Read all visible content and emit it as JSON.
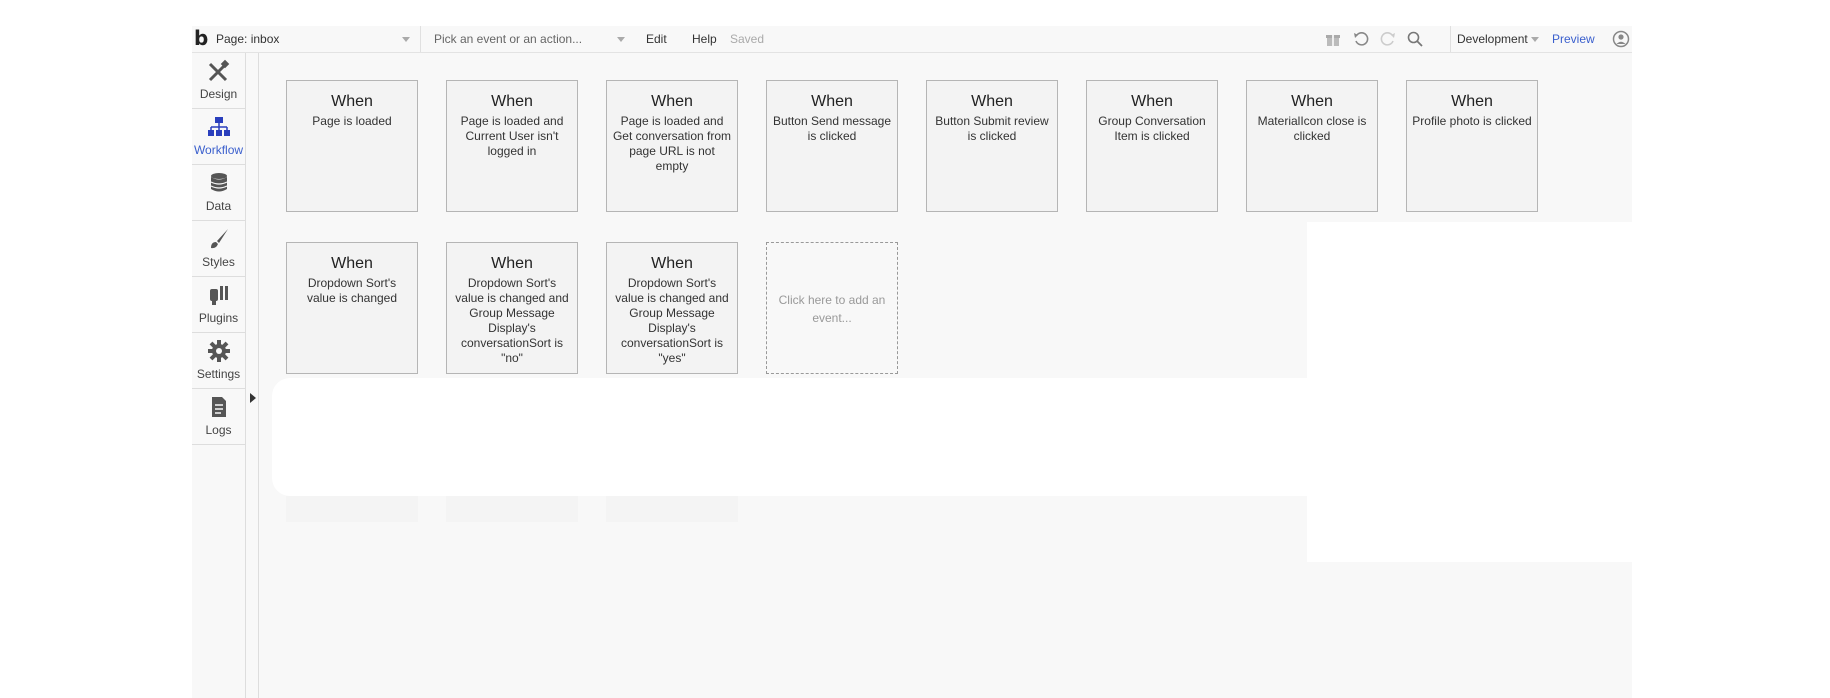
{
  "topbar": {
    "logo": "b",
    "page_label": "Page: inbox",
    "event_placeholder": "Pick an event or an action...",
    "menu": [
      "Edit",
      "Help"
    ],
    "status": "Saved",
    "environment": "Development",
    "preview": "Preview"
  },
  "sidebar": {
    "items": [
      {
        "label": "Design",
        "icon": "design-icon"
      },
      {
        "label": "Workflow",
        "icon": "workflow-icon",
        "active": true
      },
      {
        "label": "Data",
        "icon": "database-icon"
      },
      {
        "label": "Styles",
        "icon": "brush-icon"
      },
      {
        "label": "Plugins",
        "icon": "plug-icon"
      },
      {
        "label": "Settings",
        "icon": "gear-icon"
      },
      {
        "label": "Logs",
        "icon": "document-icon"
      }
    ]
  },
  "workflows": {
    "row1": [
      {
        "when": "When",
        "condition": "Page is loaded"
      },
      {
        "when": "When",
        "condition": "Page is loaded and Current User isn't logged in"
      },
      {
        "when": "When",
        "condition": "Page is loaded and Get conversation from page URL is not empty"
      },
      {
        "when": "When",
        "condition": "Button Send message is clicked"
      },
      {
        "when": "When",
        "condition": "Button Submit review is clicked"
      },
      {
        "when": "When",
        "condition": "Group Conversation Item is clicked"
      },
      {
        "when": "When",
        "condition": "MaterialIcon close is clicked"
      },
      {
        "when": "When",
        "condition": "Profile photo is clicked"
      }
    ],
    "row2": [
      {
        "when": "When",
        "condition": "Dropdown Sort's value is changed"
      },
      {
        "when": "When",
        "condition": "Dropdown Sort's value is changed and Group Message Display's conversationSort is \"no\""
      },
      {
        "when": "When",
        "condition": "Dropdown Sort's value is changed and Group Message Display's conversationSort is \"yes\""
      }
    ],
    "add_event": "Click here to add an event..."
  }
}
